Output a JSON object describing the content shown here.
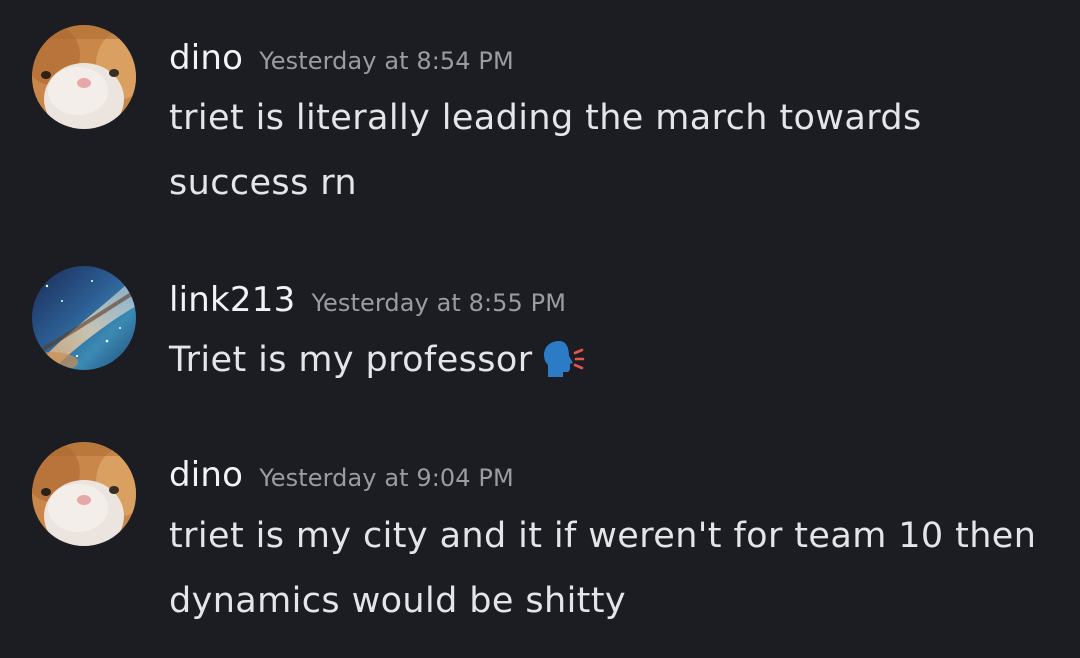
{
  "messages": [
    {
      "username": "dino",
      "timestamp": "Yesterday at 8:54 PM",
      "text": "triet is literally leading the march towards success rn",
      "avatar": "cat-avatar"
    },
    {
      "username": "link213",
      "timestamp": "Yesterday at 8:55 PM",
      "text": "Triet is my professor",
      "emoji": "speaking-head-icon",
      "avatar": "galaxy-avatar"
    },
    {
      "username": "dino",
      "timestamp": "Yesterday at 9:04 PM",
      "text": "triet is my city and it if weren't for team 10 then dynamics would be shitty",
      "avatar": "cat-avatar"
    }
  ],
  "colors": {
    "background": "#1c1d22",
    "username": "#f2f3f5",
    "timestamp": "#9a9ca3",
    "message_text": "#e4e5e8",
    "emoji_head": "#2b7bc6"
  }
}
